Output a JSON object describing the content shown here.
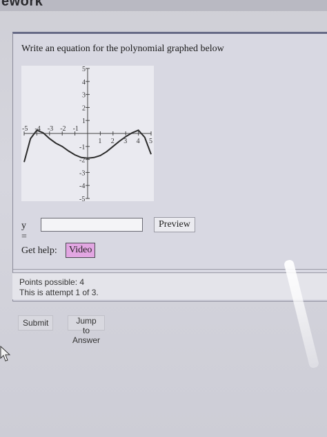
{
  "page": {
    "header_text": "ework"
  },
  "question": {
    "prompt": "Write an equation for the polynomial graphed below",
    "graph": {
      "x_ticks": [
        "-5",
        "-4",
        "-3",
        "-2",
        "-1",
        "1",
        "2",
        "3",
        "4",
        "5"
      ],
      "y_ticks": [
        "5",
        "4",
        "3",
        "2",
        "1",
        "-1",
        "-2",
        "-3",
        "-4",
        "-5"
      ],
      "xlim": [
        -5,
        5
      ],
      "ylim": [
        -5,
        5
      ],
      "curve_points": [
        [
          -5,
          -2.2
        ],
        [
          -4.5,
          -0.4
        ],
        [
          -4,
          0.25
        ],
        [
          -3.5,
          0.05
        ],
        [
          -3,
          -0.4
        ],
        [
          -2.5,
          -0.75
        ],
        [
          -2,
          -1.0
        ],
        [
          -1.5,
          -1.35
        ],
        [
          -1,
          -1.65
        ],
        [
          -0.5,
          -1.85
        ],
        [
          0,
          -1.9
        ],
        [
          0.5,
          -1.85
        ],
        [
          1,
          -1.7
        ],
        [
          1.5,
          -1.4
        ],
        [
          2,
          -1.0
        ],
        [
          2.5,
          -0.6
        ],
        [
          3,
          -0.25
        ],
        [
          3.5,
          0.05
        ],
        [
          4,
          0.25
        ],
        [
          4.5,
          -0.3
        ],
        [
          5,
          -1.6
        ]
      ],
      "curve_color": "#2b2b2b",
      "grid": false
    },
    "answer": {
      "label": "y =",
      "value": ""
    },
    "preview_label": "Preview",
    "help_label": "Get help:",
    "video_label": "Video"
  },
  "info": {
    "points_possible": "Points possible: 4",
    "attempt": "This is attempt 1 of 3."
  },
  "buttons": {
    "submit": "Submit",
    "jump": "Jump to Answer"
  },
  "colors": {
    "video_button": "#e2a6e2",
    "box_border_top": "#666a86"
  }
}
